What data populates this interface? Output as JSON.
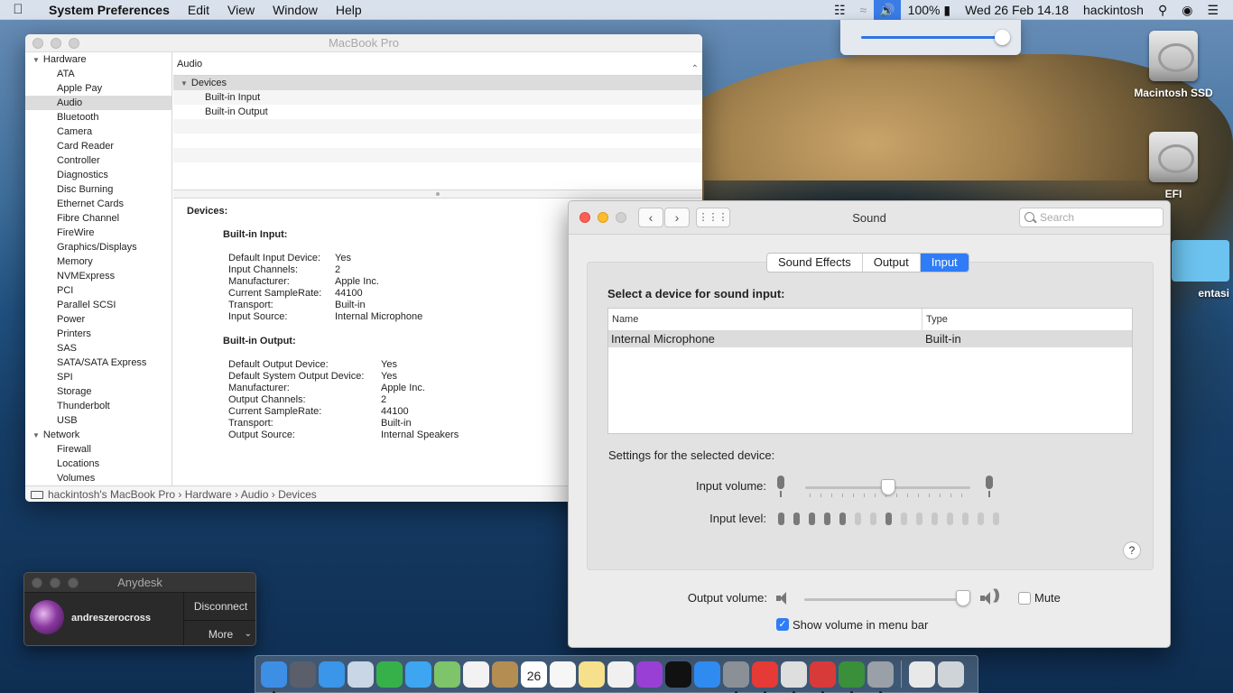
{
  "menubar": {
    "app_name": "System Preferences",
    "menus": [
      "Edit",
      "View",
      "Window",
      "Help"
    ],
    "battery": "100%",
    "datetime": "Wed 26 Feb  14.18",
    "user": "hackintosh"
  },
  "volume_popup": {
    "level": 0.98
  },
  "desktop": {
    "icons": [
      {
        "label": "Macintosh SSD"
      },
      {
        "label": "EFI"
      },
      {
        "label": "entasi"
      }
    ]
  },
  "sysinfo": {
    "title": "MacBook Pro",
    "sidebar": [
      {
        "label": "Hardware",
        "group": true
      },
      {
        "label": "ATA"
      },
      {
        "label": "Apple Pay"
      },
      {
        "label": "Audio",
        "selected": true
      },
      {
        "label": "Bluetooth"
      },
      {
        "label": "Camera"
      },
      {
        "label": "Card Reader"
      },
      {
        "label": "Controller"
      },
      {
        "label": "Diagnostics"
      },
      {
        "label": "Disc Burning"
      },
      {
        "label": "Ethernet Cards"
      },
      {
        "label": "Fibre Channel"
      },
      {
        "label": "FireWire"
      },
      {
        "label": "Graphics/Displays"
      },
      {
        "label": "Memory"
      },
      {
        "label": "NVMExpress"
      },
      {
        "label": "PCI"
      },
      {
        "label": "Parallel SCSI"
      },
      {
        "label": "Power"
      },
      {
        "label": "Printers"
      },
      {
        "label": "SAS"
      },
      {
        "label": "SATA/SATA Express"
      },
      {
        "label": "SPI"
      },
      {
        "label": "Storage"
      },
      {
        "label": "Thunderbolt"
      },
      {
        "label": "USB"
      },
      {
        "label": "Network",
        "group": true
      },
      {
        "label": "Firewall"
      },
      {
        "label": "Locations"
      },
      {
        "label": "Volumes"
      }
    ],
    "content_header": "Audio",
    "tree": {
      "group": "Devices",
      "items": [
        "Built-in Input",
        "Built-in Output"
      ]
    },
    "detail": {
      "heading": "Devices:",
      "input_title": "Built-in Input:",
      "input": [
        [
          "Default Input Device:",
          "Yes"
        ],
        [
          "Input Channels:",
          "2"
        ],
        [
          "Manufacturer:",
          "Apple Inc."
        ],
        [
          "Current SampleRate:",
          "44100"
        ],
        [
          "Transport:",
          "Built-in"
        ],
        [
          "Input Source:",
          "Internal Microphone"
        ]
      ],
      "output_title": "Built-in Output:",
      "output": [
        [
          "Default Output Device:",
          "Yes"
        ],
        [
          "Default System Output Device:",
          "Yes"
        ],
        [
          "Manufacturer:",
          "Apple Inc."
        ],
        [
          "Output Channels:",
          "2"
        ],
        [
          "Current SampleRate:",
          "44100"
        ],
        [
          "Transport:",
          "Built-in"
        ],
        [
          "Output Source:",
          "Internal Speakers"
        ]
      ]
    },
    "breadcrumb": "hackintosh's MacBook Pro  ›  Hardware  ›  Audio  ›  Devices"
  },
  "anydesk": {
    "title": "Anydesk",
    "username": "andreszerocross",
    "disconnect": "Disconnect",
    "more": "More"
  },
  "sound": {
    "title": "Sound",
    "search_placeholder": "Search",
    "tabs": [
      "Sound Effects",
      "Output",
      "Input"
    ],
    "active_tab": "Input",
    "select_title": "Select a device for sound input:",
    "columns": [
      "Name",
      "Type"
    ],
    "devices": [
      {
        "name": "Internal Microphone",
        "type": "Built-in"
      }
    ],
    "settings_label": "Settings for the selected device:",
    "input_volume_label": "Input volume:",
    "input_volume": 0.5,
    "input_level_label": "Input level:",
    "input_level_bars_lit": [
      1,
      1,
      1,
      1,
      1,
      0,
      0,
      1,
      0,
      0,
      0,
      0,
      0,
      0,
      0
    ],
    "help": "?",
    "output_volume_label": "Output volume:",
    "output_volume": 0.96,
    "mute_label": "Mute",
    "mute_checked": false,
    "show_volume_label": "Show volume in menu bar",
    "show_volume_checked": true
  },
  "dock": {
    "calendar_day": "26",
    "items": [
      {
        "name": "finder",
        "color": "#3d8fe6"
      },
      {
        "name": "launchpad",
        "color": "#5a5f6b"
      },
      {
        "name": "safari",
        "color": "#3b95e8"
      },
      {
        "name": "mail",
        "color": "#c9d6e6"
      },
      {
        "name": "facetime",
        "color": "#36b14a"
      },
      {
        "name": "messages",
        "color": "#3ea5f1"
      },
      {
        "name": "maps",
        "color": "#7ec46a"
      },
      {
        "name": "photos",
        "color": "#f2f2f2"
      },
      {
        "name": "contacts",
        "color": "#b48d52"
      },
      {
        "name": "calendar",
        "color": "#ffffff"
      },
      {
        "name": "reminders",
        "color": "#f6f6f6"
      },
      {
        "name": "notes",
        "color": "#f7e08b"
      },
      {
        "name": "music",
        "color": "#f0f0f0"
      },
      {
        "name": "podcasts",
        "color": "#9a3fd6"
      },
      {
        "name": "tv",
        "color": "#111111"
      },
      {
        "name": "app-store",
        "color": "#2f8bf0"
      },
      {
        "name": "system-preferences",
        "color": "#8b8f96"
      },
      {
        "name": "anydesk",
        "color": "#e53a35"
      },
      {
        "name": "textedit",
        "color": "#dedede"
      },
      {
        "name": "app-red",
        "color": "#d83a3a"
      },
      {
        "name": "app-green",
        "color": "#3a8f3a"
      },
      {
        "name": "app-utility",
        "color": "#9aa0a8"
      },
      {
        "name": "documents",
        "color": "#e8e8e8"
      },
      {
        "name": "trash",
        "color": "#cfd4d9"
      }
    ]
  }
}
